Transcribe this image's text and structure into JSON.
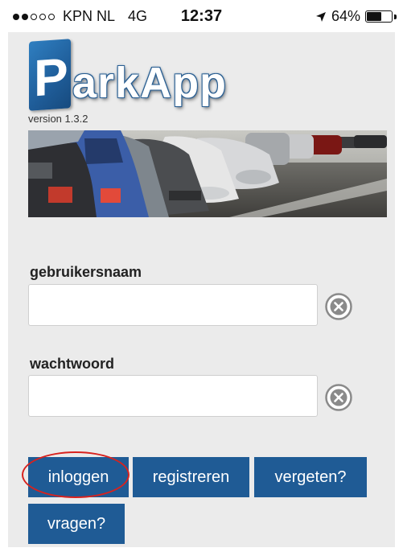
{
  "status_bar": {
    "carrier": "KPN NL",
    "network": "4G",
    "time": "12:37",
    "battery": "64%",
    "battery_level": 0.64,
    "signal_strength_dots": 2,
    "location_icon": "location-arrow-icon"
  },
  "app": {
    "name_initial": "P",
    "name_rest": "arkApp",
    "version": "version 1.3.2"
  },
  "form": {
    "username_label": "gebruikersnaam",
    "username_value": "",
    "password_label": "wachtwoord",
    "password_value": "",
    "clear_icon": "clear-circle-icon"
  },
  "buttons": {
    "login": "inloggen",
    "register": "registreren",
    "forgot": "vergeten?",
    "questions": "vragen?"
  },
  "colors": {
    "accent": "#1f5b95",
    "panel_background": "#ebebeb",
    "highlight": "#d8221e"
  }
}
